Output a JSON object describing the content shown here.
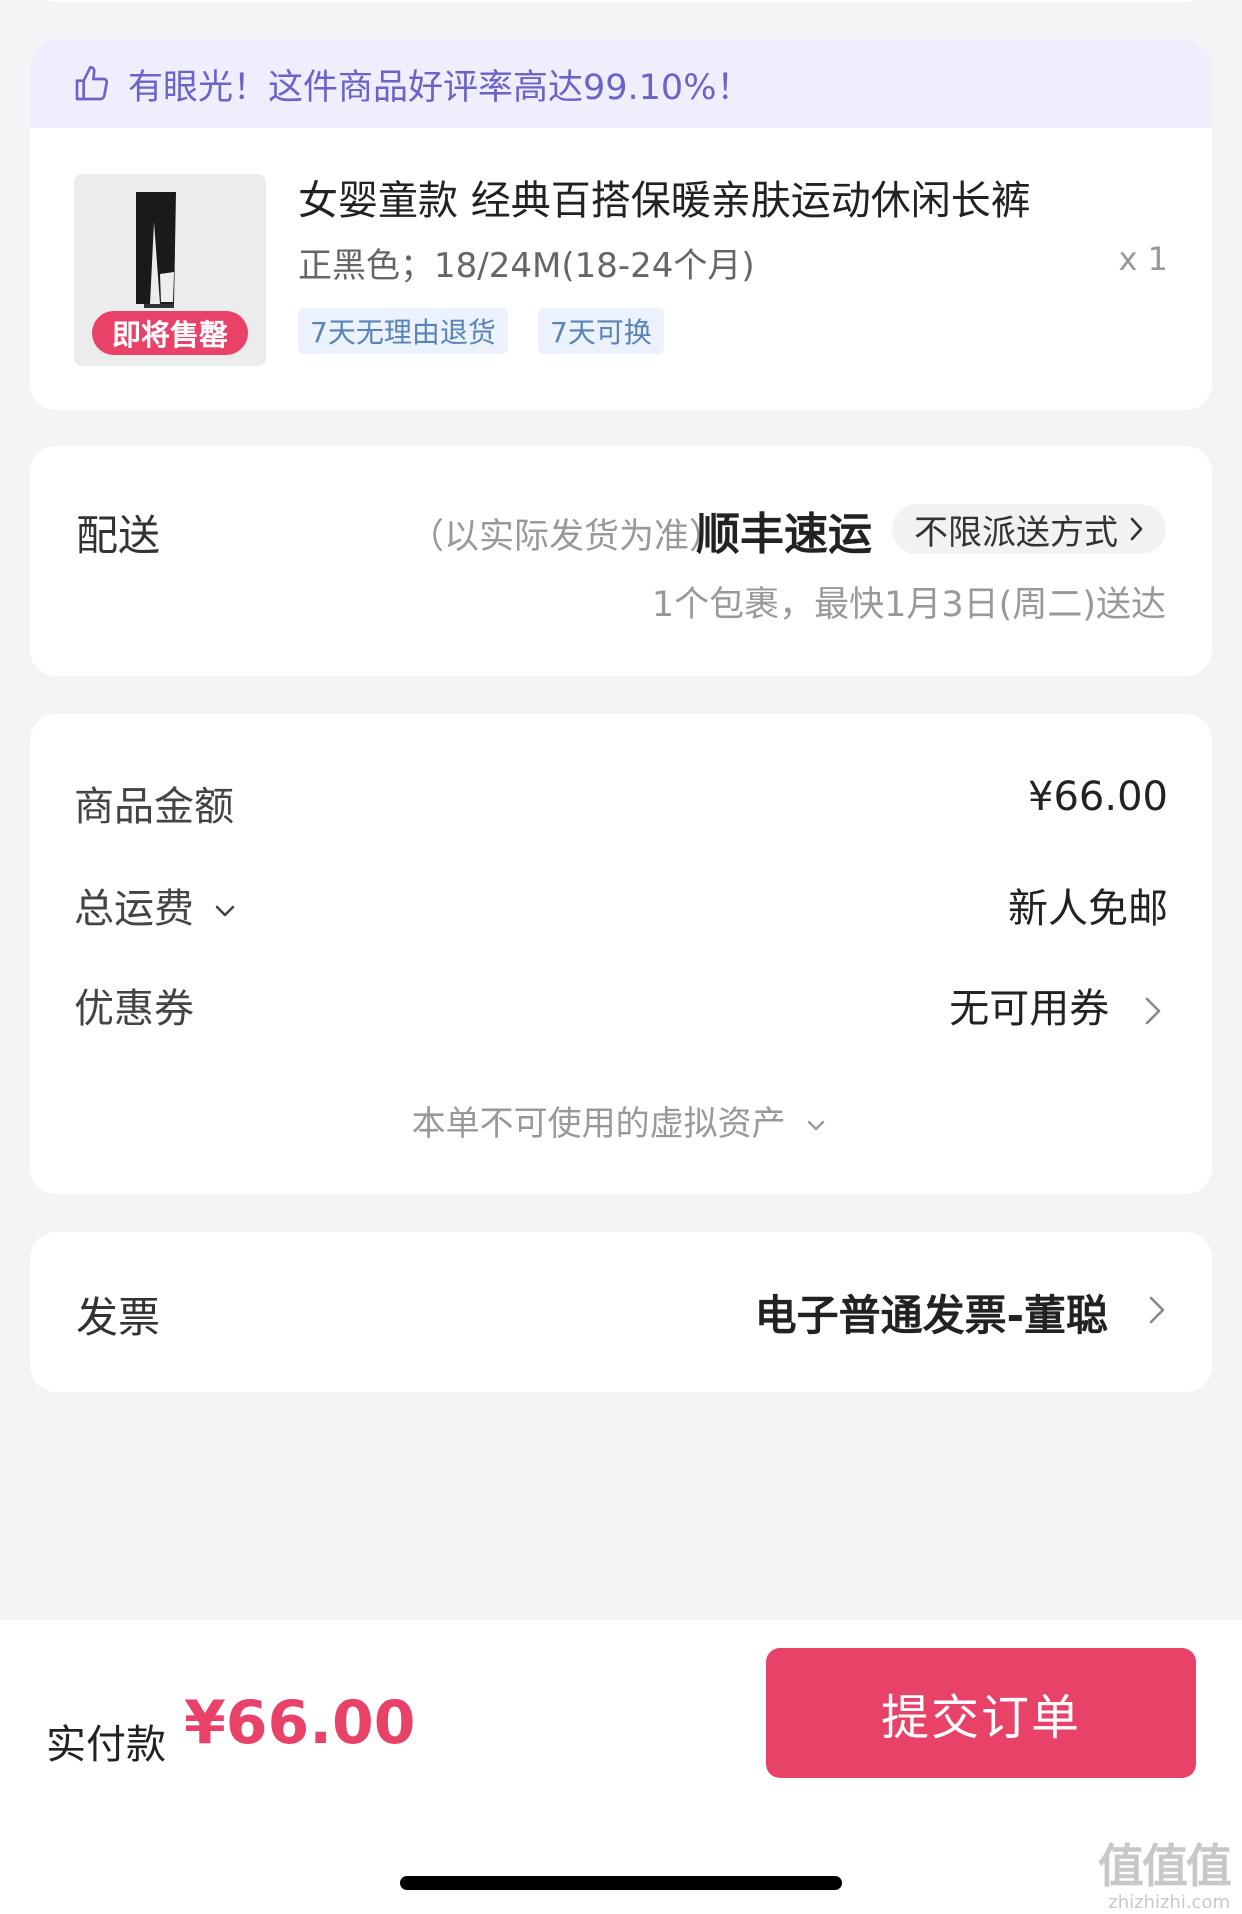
{
  "product": {
    "promo": "有眼光！这件商品好评率高达99.10%！",
    "badge": "即将售罄",
    "title": "女婴童款 经典百搭保暖亲肤运动休闲长裤",
    "spec": "正黑色；18/24M(18-24个月)",
    "qty": "x 1",
    "tags": [
      "7天无理由退货",
      "7天可换"
    ]
  },
  "delivery": {
    "label": "配送",
    "note": "（以实际发货为准）",
    "carrier": "顺丰速运",
    "method": "不限派送方式",
    "eta": "1个包裹，最快1月3日(周二)送达"
  },
  "totals": {
    "goods_label": "商品金额",
    "goods_value": "¥66.00",
    "shipping_label": "总运费",
    "shipping_value": "新人免邮",
    "coupon_label": "优惠券",
    "coupon_value": "无可用券",
    "virtual_note": "本单不可使用的虚拟资产"
  },
  "invoice": {
    "label": "发票",
    "value": "电子普通发票-董聪"
  },
  "footer": {
    "pay_label": "实付款",
    "pay_amount": "¥66.00",
    "submit_label": "提交订单",
    "watermark_glyphs": "值值值",
    "watermark_site": "zhizhizhi.com"
  },
  "colors": {
    "accent": "#e84268",
    "promo_text": "#6b63c9",
    "promo_bg": "#efeefc",
    "tag_text": "#5a83b8",
    "tag_bg": "#ebf2fc"
  }
}
